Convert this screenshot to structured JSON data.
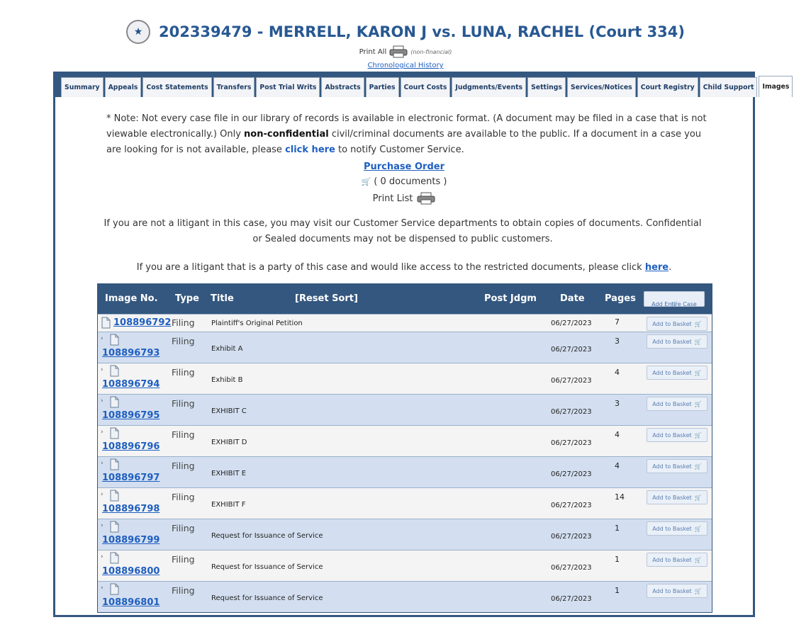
{
  "header": {
    "title": "202339479 - MERRELL, KARON J vs. LUNA, RACHEL (Court 334)",
    "print_all": "Print All",
    "non_financial": "(non-financial)",
    "chrono_link": "Chronological History"
  },
  "tabs": [
    {
      "label": "Summary"
    },
    {
      "label": "Appeals"
    },
    {
      "label": "Cost Statements"
    },
    {
      "label": "Transfers"
    },
    {
      "label": "Post Trial Writs"
    },
    {
      "label": "Abstracts"
    },
    {
      "label": "Parties"
    },
    {
      "label": "Court Costs"
    },
    {
      "label": "Judgments/Events"
    },
    {
      "label": "Settings"
    },
    {
      "label": "Services/Notices"
    },
    {
      "label": "Court Registry"
    },
    {
      "label": "Child Support"
    },
    {
      "label": "Images",
      "active": true
    }
  ],
  "note": {
    "part1": "* Note: Not every case file in our library of records is available in electronic format. (A document may be filed in a case that is not viewable electronically.) Only ",
    "bold": "non-confidential",
    "part2": " civil/criminal documents are available to the public. If a document in a case you are looking for is not available, please ",
    "link": "click here",
    "part3": " to notify Customer Service."
  },
  "purchase_order": "Purchase Order",
  "documents_count": "( 0 documents )",
  "print_list": "Print List",
  "visit_text": "If you are not a litigant in this case, you may visit our Customer Service departments to obtain copies of documents. Confidential or Sealed documents may not be dispensed to public customers.",
  "litigant": {
    "text": "If you are a litigant that is a party of this case and would like access to the restricted documents, please click ",
    "link": "here",
    "end": "."
  },
  "grid": {
    "headers": {
      "image_no": "Image No.",
      "type": "Type",
      "title": "Title",
      "reset": "[Reset Sort]",
      "post_jdgm": "Post Jdgm",
      "date": "Date",
      "pages": "Pages",
      "add_case": "Add Entire Case"
    },
    "basket_label": "Add to Basket",
    "rows": [
      {
        "image_no": "108896792",
        "type": "Filing",
        "title": "Plaintiff's Original Petition",
        "date": "06/27/2023",
        "pages": "7"
      },
      {
        "image_no": "108896793",
        "type": "Filing",
        "title": "Exhibit A",
        "date": "06/27/2023",
        "pages": "3"
      },
      {
        "image_no": "108896794",
        "type": "Filing",
        "title": "Exhibit B",
        "date": "06/27/2023",
        "pages": "4"
      },
      {
        "image_no": "108896795",
        "type": "Filing",
        "title": "EXHIBIT C",
        "date": "06/27/2023",
        "pages": "3"
      },
      {
        "image_no": "108896796",
        "type": "Filing",
        "title": "EXHIBIT D",
        "date": "06/27/2023",
        "pages": "4"
      },
      {
        "image_no": "108896797",
        "type": "Filing",
        "title": "EXHIBIT E",
        "date": "06/27/2023",
        "pages": "4"
      },
      {
        "image_no": "108896798",
        "type": "Filing",
        "title": "EXHIBIT F",
        "date": "06/27/2023",
        "pages": "14"
      },
      {
        "image_no": "108896799",
        "type": "Filing",
        "title": "Request for Issuance of Service",
        "date": "06/27/2023",
        "pages": "1"
      },
      {
        "image_no": "108896800",
        "type": "Filing",
        "title": "Request for Issuance of Service",
        "date": "06/27/2023",
        "pages": "1"
      },
      {
        "image_no": "108896801",
        "type": "Filing",
        "title": "Request for Issuance of Service",
        "date": "06/27/2023",
        "pages": "1"
      }
    ]
  }
}
